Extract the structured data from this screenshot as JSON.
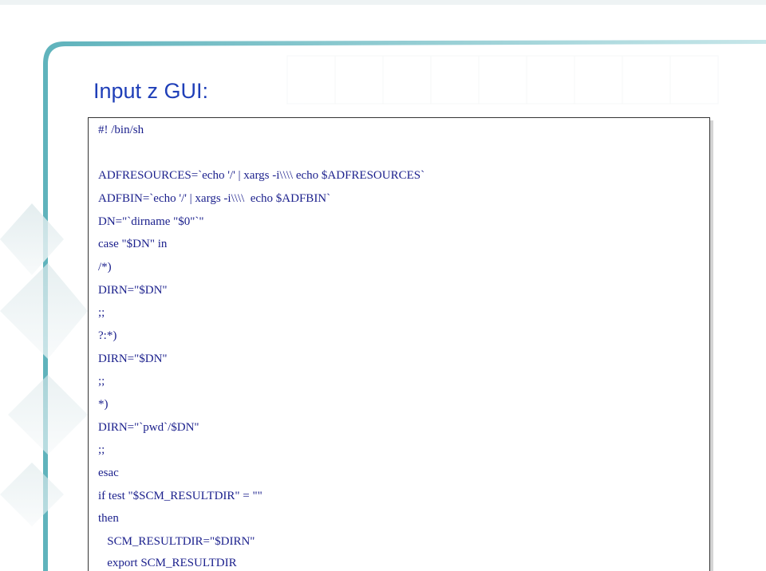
{
  "slide": {
    "title": "Input z GUI:"
  },
  "code": {
    "lines": [
      "#! /bin/sh",
      "",
      "ADFRESOURCES=`echo '/' | xargs -i\\\\\\\\ echo $ADFRESOURCES`",
      "ADFBIN=`echo '/' | xargs -i\\\\\\\\  echo $ADFBIN`",
      "DN=\"`dirname \"$0\"`\"",
      "case \"$DN\" in",
      "/*)",
      "DIRN=\"$DN\"",
      ";;",
      "?:*)",
      "DIRN=\"$DN\"",
      ";;",
      "*)",
      "DIRN=\"`pwd`/$DN\"",
      ";;",
      "esac",
      "if test \"$SCM_RESULTDIR\" = \"\"",
      "then",
      "   SCM_RESULTDIR=\"$DIRN\"",
      "   export SCM_RESULTDIR"
    ]
  },
  "colors": {
    "title": "#1f3fb8",
    "code_text": "#1a1f8c",
    "box_border": "#333333",
    "decor_teal": "#7fc3c9",
    "decor_light": "#eef3f4"
  }
}
